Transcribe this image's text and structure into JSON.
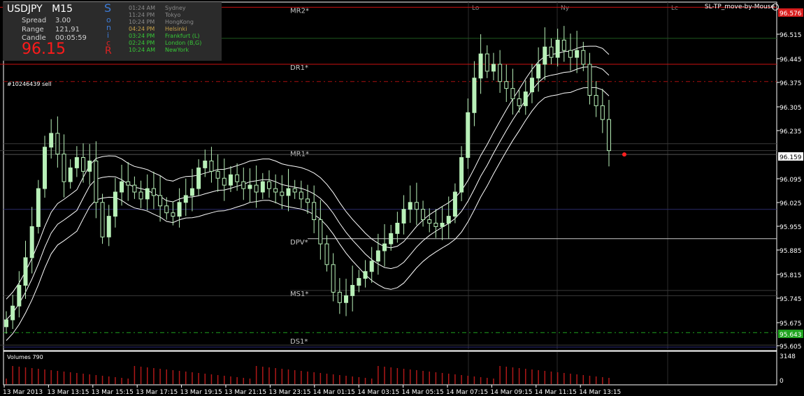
{
  "header": {
    "symbol": "USDJPY",
    "timeframe": "M15",
    "spread_label": "Spread",
    "spread_value": "3.00",
    "range_label": "Range",
    "range_value": "121,91",
    "candle_label": "Candle",
    "candle_value": "00:05:59",
    "price": "96.15",
    "sonic_letters": [
      "S",
      "o",
      "n",
      "i",
      "c",
      "R"
    ]
  },
  "sessions": [
    {
      "time": "01:24 AM",
      "name": "Sydney",
      "color": "#8a8a8a"
    },
    {
      "time": "11:24 PM",
      "name": "Tokyo",
      "color": "#8a8a8a"
    },
    {
      "time": "10:24 PM",
      "name": "HongKong",
      "color": "#8a8a8a"
    },
    {
      "time": "04:24 PM",
      "name": "Helsinki",
      "color": "#c7a24a"
    },
    {
      "time": "03:24 PM",
      "name": "Frankfurt  (L)",
      "color": "#37c837"
    },
    {
      "time": "02:24 PM",
      "name": "London  (B,G)",
      "color": "#37c837"
    },
    {
      "time": "10:24 AM",
      "name": "NewYork",
      "color": "#37c837"
    }
  ],
  "ea_name": "SL-TP_move-by-Mouse",
  "order_label": "#10246439 sell",
  "volumes_label": "Volumes 790",
  "colors": {
    "background": "#000000",
    "bull_candle": "#b8f0b8",
    "band": "#ffffff",
    "red_level": "#cc1111",
    "green_level": "#1f5a1f",
    "blue_level": "#2a2a6a",
    "volume": "#b01818",
    "price_box": "#d91e1e",
    "ask_box": "#1fa31f"
  },
  "chart_data": {
    "type": "candlestick",
    "symbol": "USDJPY",
    "timeframe": "M15",
    "ylim": [
      95.595,
      96.6
    ],
    "y_ticks": [
      "96.576",
      "96.515",
      "96.445",
      "96.375",
      "96.305",
      "96.235",
      "96.159",
      "96.095",
      "96.025",
      "95.955",
      "95.885",
      "95.815",
      "95.745",
      "95.675",
      "95.643",
      "95.605"
    ],
    "current_price": "96.159",
    "high_price": "96.576",
    "ask_line_price": "95.643",
    "x_labels": [
      "13 Mar 2013",
      "13 Mar 13:15",
      "13 Mar 15:15",
      "13 Mar 17:15",
      "13 Mar 19:15",
      "13 Mar 21:15",
      "13 Mar 23:15",
      "14 Mar 01:15",
      "14 Mar 03:15",
      "14 Mar 05:15",
      "14 Mar 07:15",
      "14 Mar 09:15",
      "14 Mar 11:15",
      "14 Mar 13:15"
    ],
    "session_markers": [
      "Lo",
      "Ny",
      "Lc"
    ],
    "pivot_levels": [
      {
        "label": "MR2*",
        "price": 96.585,
        "color": "#cc1111"
      },
      {
        "label": "DR1*",
        "price": 96.42,
        "color": "#cc1111"
      },
      {
        "label": "MR1*",
        "price": 96.17,
        "color": "#3a3a3a"
      },
      {
        "label": "DPV*",
        "price": 95.915,
        "color": "#cccccc"
      },
      {
        "label": "MS1*",
        "price": 95.765,
        "color": "#3a3a3a"
      },
      {
        "label": "DS1*",
        "price": 95.607,
        "color": "#3a3a3a"
      }
    ],
    "extra_levels": [
      {
        "price": 96.495,
        "color": "#1f5a1f",
        "dash": false
      },
      {
        "price": 96.37,
        "color": "#aa1111",
        "dash": true
      },
      {
        "price": 96.19,
        "color": "#3a3a3a",
        "dash": false
      },
      {
        "price": 96.0,
        "color": "#2a2a6a",
        "dash": false
      },
      {
        "price": 95.75,
        "color": "#3a3a3a",
        "dash": false
      },
      {
        "price": 95.643,
        "color": "#1fa31f",
        "dash": true
      },
      {
        "price": 95.601,
        "color": "#2a2a7a",
        "dash": false
      }
    ],
    "volume_ticks": [
      "3148",
      "0"
    ],
    "close_series": [
      95.68,
      95.72,
      95.78,
      95.86,
      95.95,
      96.06,
      96.18,
      96.22,
      96.16,
      96.08,
      96.12,
      96.15,
      96.11,
      96.14,
      96.02,
      95.92,
      95.98,
      96.05,
      96.08,
      96.07,
      96.05,
      96.03,
      96.06,
      96.04,
      96.01,
      95.99,
      95.98,
      96.02,
      96.04,
      96.06,
      96.12,
      96.14,
      96.11,
      96.09,
      96.07,
      96.1,
      96.08,
      96.06,
      96.07,
      96.05,
      96.08,
      96.06,
      96.05,
      96.04,
      96.06,
      96.05,
      96.03,
      96.02,
      95.97,
      95.9,
      95.84,
      95.76,
      95.73,
      95.75,
      95.78,
      95.8,
      95.82,
      95.85,
      95.88,
      95.9,
      95.93,
      95.96,
      96.0,
      96.02,
      96.0,
      95.97,
      95.96,
      95.95,
      95.96,
      95.98,
      96.05,
      96.15,
      96.28,
      96.38,
      96.45,
      96.4,
      96.42,
      96.37,
      96.35,
      96.32,
      96.3,
      96.34,
      96.38,
      96.42,
      96.47,
      96.44,
      96.49,
      96.46,
      96.44,
      96.46,
      96.42,
      96.33,
      96.3,
      96.26,
      96.17
    ]
  }
}
